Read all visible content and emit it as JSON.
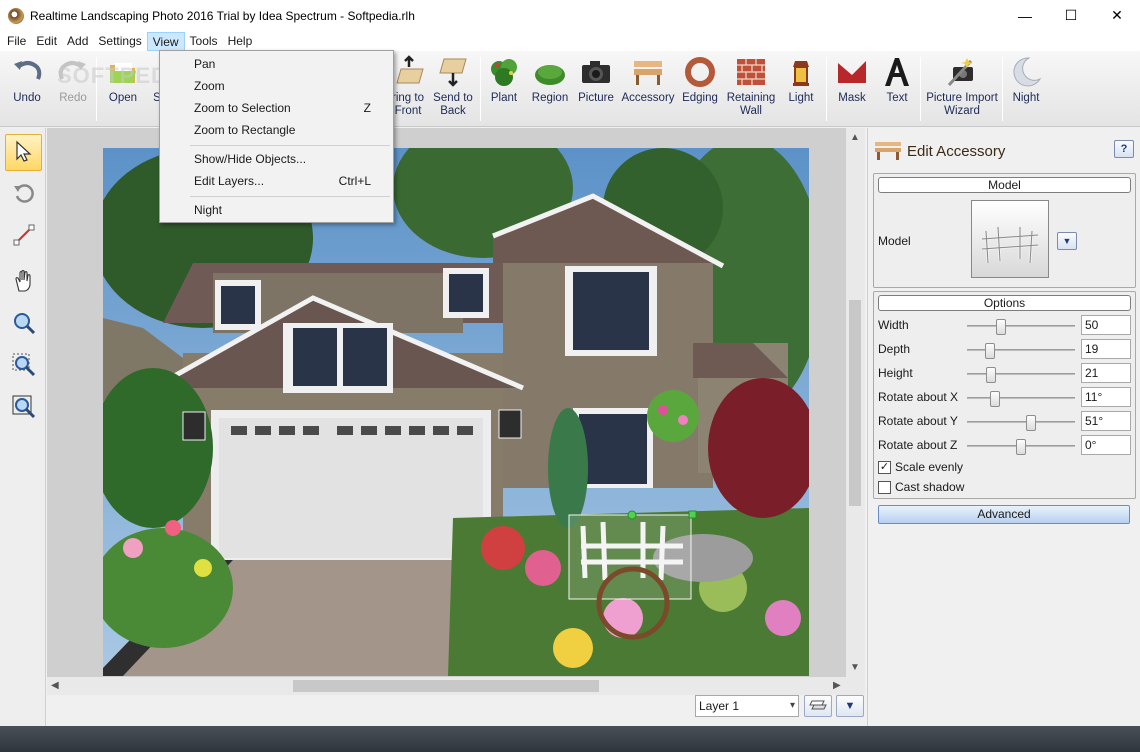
{
  "window": {
    "title": "Realtime Landscaping Photo 2016 Trial by Idea Spectrum - Softpedia.rlh",
    "minimize": "—",
    "maximize": "☐",
    "close": "✕"
  },
  "menubar": {
    "items": [
      "File",
      "Edit",
      "Add",
      "Settings",
      "View",
      "Tools",
      "Help"
    ],
    "active": "View"
  },
  "view_menu": {
    "items": [
      {
        "label": "Pan",
        "shortcut": ""
      },
      {
        "label": "Zoom",
        "shortcut": ""
      },
      {
        "label": "Zoom to Selection",
        "shortcut": "Z"
      },
      {
        "label": "Zoom to Rectangle",
        "shortcut": ""
      },
      {
        "label": "Show/Hide Objects...",
        "shortcut": ""
      },
      {
        "label": "Edit Layers...",
        "shortcut": "Ctrl+L"
      },
      {
        "label": "Night",
        "shortcut": ""
      }
    ]
  },
  "toolbar": {
    "undo": "Undo",
    "redo": "Redo",
    "open": "Open",
    "save_partial": "S",
    "bring_to_front": "Bring to Front",
    "bring_to_front_visible_line1": "ring to",
    "bring_to_front_visible_line2": "Front",
    "send_to_back_line1": "Send to",
    "send_to_back_line2": "Back",
    "plant": "Plant",
    "region": "Region",
    "picture": "Picture",
    "accessory": "Accessory",
    "edging": "Edging",
    "retaining_wall_line1": "Retaining",
    "retaining_wall_line2": "Wall",
    "light": "Light",
    "mask": "Mask",
    "text": "Text",
    "picture_import_line1": "Picture Import",
    "picture_import_line2": "Wizard",
    "night": "Night",
    "watermark": "SOFTPEDIA"
  },
  "left_tools": [
    "select-tool",
    "rotate-tool",
    "line-tool",
    "pan-tool",
    "zoom-tool",
    "zoom-selection-tool",
    "zoom-rectangle-tool"
  ],
  "layer_bar": {
    "layer": "Layer 1"
  },
  "edit_panel": {
    "title": "Edit Accessory",
    "help": "?",
    "model_group": "Model",
    "model_label": "Model",
    "options_group": "Options",
    "properties": [
      {
        "label": "Width",
        "value": "50",
        "slider": 0.3
      },
      {
        "label": "Depth",
        "value": "19",
        "slider": 0.2
      },
      {
        "label": "Height",
        "value": "21",
        "slider": 0.21
      },
      {
        "label": "Rotate about X",
        "value": "11°",
        "slider": 0.25
      },
      {
        "label": "Rotate about Y",
        "value": "51°",
        "slider": 0.58
      },
      {
        "label": "Rotate about Z",
        "value": "0°",
        "slider": 0.5
      }
    ],
    "scale_evenly": "Scale evenly",
    "scale_evenly_checked": true,
    "cast_shadow": "Cast shadow",
    "cast_shadow_checked": false,
    "advanced": "Advanced"
  }
}
